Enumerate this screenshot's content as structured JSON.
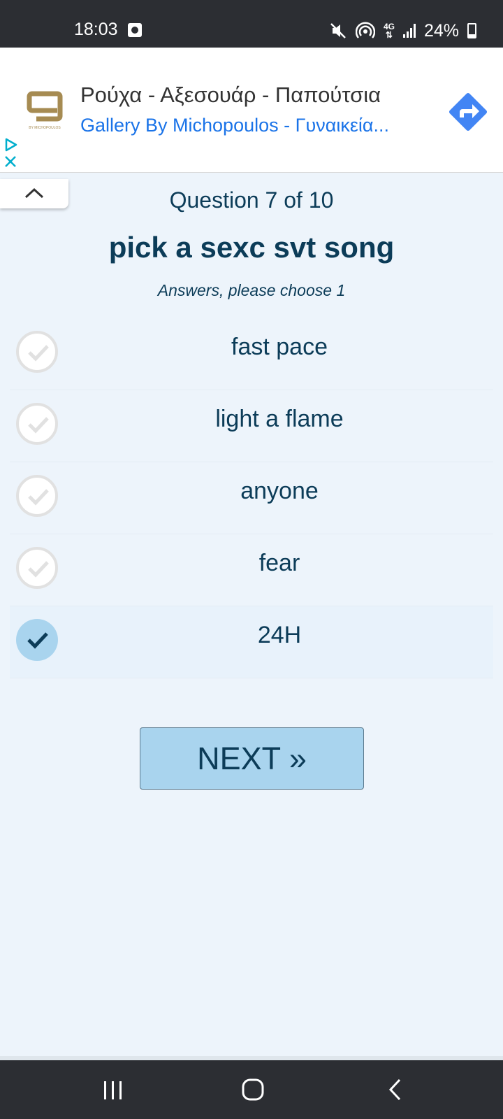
{
  "status_bar": {
    "time": "18:03",
    "battery": "24%",
    "network": "4G",
    "icons": [
      "media-icon",
      "mute-icon",
      "hotspot-icon",
      "network-4g-icon",
      "signal-icon",
      "battery-icon"
    ]
  },
  "ad": {
    "title": "Ρούχα - Αξεσουάρ - Παπούτσια",
    "subtitle": "Gallery By Michopoulos - Γυναικεία...",
    "logo_caption": "BY MICHOPOULOS",
    "accent_color": "#1a73e8",
    "logo_color": "#a68b52"
  },
  "quiz": {
    "counter": "Question 7 of 10",
    "question": "pick a sexc svt song",
    "hint": "Answers, please choose 1",
    "answers": [
      {
        "label": "fast pace",
        "selected": false
      },
      {
        "label": "light a flame",
        "selected": false
      },
      {
        "label": "anyone",
        "selected": false
      },
      {
        "label": "fear",
        "selected": false
      },
      {
        "label": "24H",
        "selected": true
      }
    ],
    "next_label": "NEXT »",
    "text_color": "#0c3c58",
    "selected_color": "#a9d4ee",
    "background_color": "#edf4fb"
  }
}
